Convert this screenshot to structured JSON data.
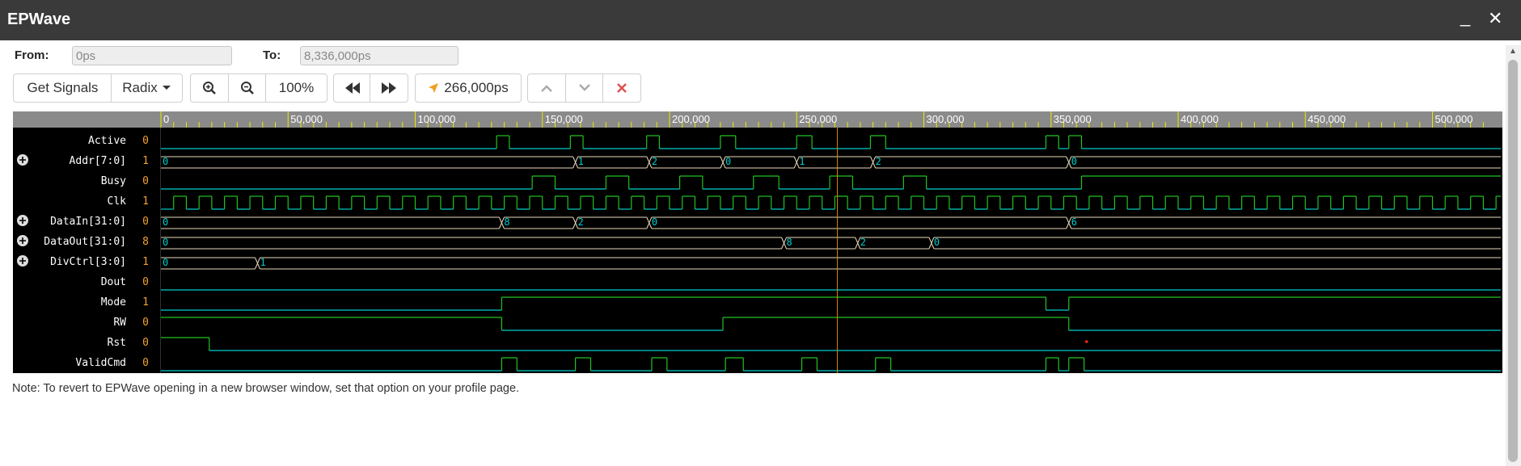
{
  "window": {
    "title": "EPWave",
    "minimize_glyph": "_",
    "close_glyph": "✕"
  },
  "range": {
    "from_label": "From:",
    "from_value": "0ps",
    "to_label": "To:",
    "to_value": "8,336,000ps"
  },
  "toolbar": {
    "get_signals": "Get Signals",
    "radix": "Radix",
    "zoom_level": "100%",
    "cursor_time": "266,000ps",
    "icons": [
      "zoom-in-icon",
      "zoom-out-icon",
      "rewind-icon",
      "fast-forward-icon",
      "cursor-icon",
      "chevron-up-icon",
      "chevron-down-icon",
      "close-icon"
    ]
  },
  "ruler": {
    "labels": [
      "0",
      "50,000",
      "100,000",
      "150,000",
      "200,000",
      "250,000",
      "300,000",
      "350,000",
      "400,000",
      "450,000",
      "500,000"
    ]
  },
  "waveform": {
    "cursor_time": 266000,
    "signals": [
      {
        "name": "Active",
        "value": "0",
        "bus": false
      },
      {
        "name": "Addr[7:0]",
        "value": "1",
        "bus": true,
        "segments": [
          "0",
          "1",
          "2",
          "0",
          "1",
          "2",
          "0"
        ]
      },
      {
        "name": "Busy",
        "value": "0",
        "bus": false
      },
      {
        "name": "Clk",
        "value": "1",
        "bus": false
      },
      {
        "name": "DataIn[31:0]",
        "value": "0",
        "bus": true,
        "segments": [
          "0",
          "8",
          "2",
          "0",
          "6"
        ]
      },
      {
        "name": "DataOut[31:0]",
        "value": "8",
        "bus": true,
        "segments": [
          "0",
          "8",
          "2",
          "0"
        ]
      },
      {
        "name": "DivCtrl[3:0]",
        "value": "1",
        "bus": true,
        "segments": [
          "0",
          "1"
        ]
      },
      {
        "name": "Dout",
        "value": "0",
        "bus": false
      },
      {
        "name": "Mode",
        "value": "1",
        "bus": false
      },
      {
        "name": "RW",
        "value": "0",
        "bus": false
      },
      {
        "name": "Rst",
        "value": "0",
        "bus": false
      },
      {
        "name": "ValidCmd",
        "value": "0",
        "bus": false
      }
    ]
  },
  "note": "Note: To revert to EPWave opening in a new browser window, set that option on your profile page.",
  "colors": {
    "background": "#000000",
    "high": "#22c322",
    "low": "#00cccc",
    "bus": "#e8d8b8",
    "ruler": "#8a8a8a",
    "tick": "#e8e800",
    "cursor": "#e08a00",
    "value": "#f0a030"
  }
}
